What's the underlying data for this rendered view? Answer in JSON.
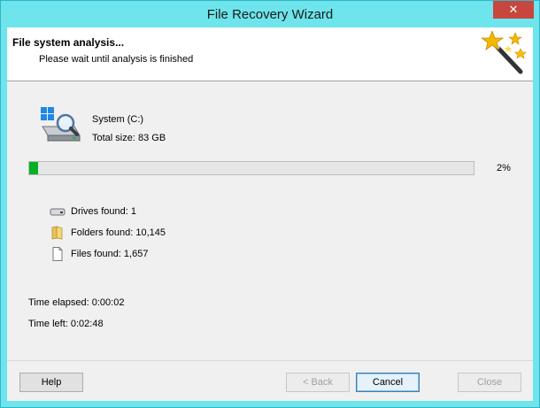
{
  "window": {
    "title": "File Recovery Wizard",
    "close_glyph": "✕"
  },
  "header": {
    "title": "File system analysis...",
    "subtitle": "Please wait until analysis is finished",
    "icon": "magic-wand-icon"
  },
  "drive": {
    "icon": "hard-drive-search-icon",
    "name": "System (C:)",
    "total_size": "Total size: 83 GB"
  },
  "progress": {
    "value": 0.02,
    "label": "2%",
    "color": "#06b025"
  },
  "stats": [
    {
      "icon": "drive-icon",
      "label": "Drives found: 1"
    },
    {
      "icon": "folder-icon",
      "label": "Folders found: 10,145"
    },
    {
      "icon": "file-icon",
      "label": "Files found: 1,657"
    }
  ],
  "time": {
    "elapsed": "Time elapsed: 0:00:02",
    "left": "Time left: 0:02:48"
  },
  "buttons": {
    "help": "Help",
    "back": "< Back",
    "cancel": "Cancel",
    "close": "Close"
  }
}
